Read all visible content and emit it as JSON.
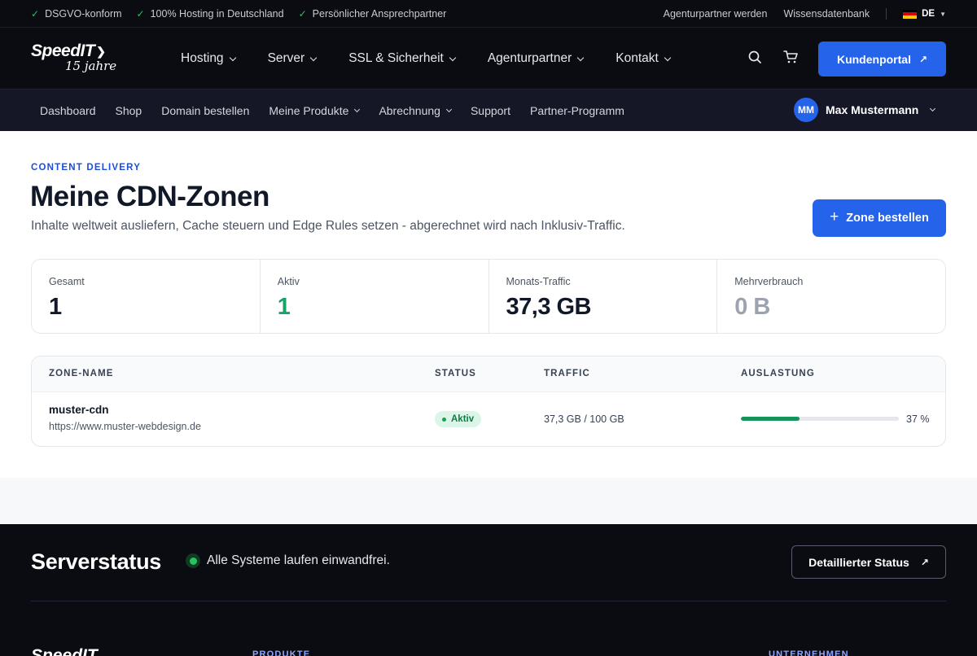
{
  "topbar": {
    "usps": [
      "DSGVO-konform",
      "100% Hosting in Deutschland",
      "Persönlicher Ansprechpartner"
    ],
    "links": [
      "Agenturpartner werden",
      "Wissensdatenbank"
    ],
    "language": "DE"
  },
  "header": {
    "logo_text": "SpeedIT",
    "logo_years": "15 jahre",
    "nav": [
      "Hosting",
      "Server",
      "SSL & Sicherheit",
      "Agenturpartner",
      "Kontakt"
    ],
    "portal_label": "Kundenportal"
  },
  "subnav": {
    "items": [
      {
        "label": "Dashboard",
        "dropdown": false
      },
      {
        "label": "Shop",
        "dropdown": false
      },
      {
        "label": "Domain bestellen",
        "dropdown": false
      },
      {
        "label": "Meine Produkte",
        "dropdown": true
      },
      {
        "label": "Abrechnung",
        "dropdown": true
      },
      {
        "label": "Support",
        "dropdown": false
      },
      {
        "label": "Partner-Programm",
        "dropdown": false
      }
    ],
    "user_initials": "MM",
    "user_name": "Max Mustermann"
  },
  "page": {
    "eyebrow": "CONTENT DELIVERY",
    "title": "Meine CDN-Zonen",
    "subtitle": "Inhalte weltweit ausliefern, Cache steuern und Edge Rules setzen - abgerechnet wird nach Inklusiv-Traffic.",
    "order_button": "Zone bestellen"
  },
  "stats": [
    {
      "label": "Gesamt",
      "value": "1",
      "color": "#111827"
    },
    {
      "label": "Aktiv",
      "value": "1",
      "color": "#16a36a"
    },
    {
      "label": "Monats-Traffic",
      "value": "37,3 GB",
      "color": "#111827"
    },
    {
      "label": "Mehrverbrauch",
      "value": "0 B",
      "color": "#9ca3af"
    }
  ],
  "table": {
    "headers": [
      "ZONE-NAME",
      "STATUS",
      "TRAFFIC",
      "AUSLASTUNG"
    ],
    "rows": [
      {
        "name": "muster-cdn",
        "url": "https://www.muster-webdesign.de",
        "status": "Aktiv",
        "traffic": "37,3 GB / 100 GB",
        "usage_pct": 37,
        "usage_label": "37 %"
      }
    ]
  },
  "footer": {
    "status_title": "Serverstatus",
    "status_text": "Alle Systeme laufen einwandfrei.",
    "detail_button": "Detaillierter Status",
    "logo_text": "SpeedIT",
    "col_products": "PRODUKTE",
    "col_company": "UNTERNEHMEN"
  },
  "colors": {
    "accent": "#2563eb",
    "success": "#16a34a",
    "dark": "#0b0c12"
  }
}
